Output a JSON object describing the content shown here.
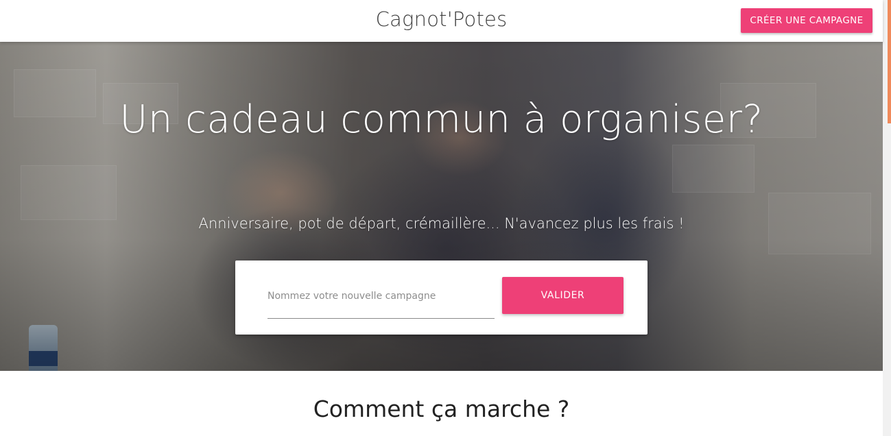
{
  "header": {
    "brand": "Cagnot'Potes",
    "create_campaign_label": "CRÉER UNE CAMPAGNE"
  },
  "hero": {
    "title": "Un cadeau commun à organiser?",
    "subtitle": "Anniversaire, pot de départ, crémaillère... N'avancez plus les frais !",
    "form": {
      "input_value": "",
      "input_placeholder": "Nommez votre nouvelle campagne",
      "submit_label": "VALIDER"
    }
  },
  "how_it_works": {
    "title": "Comment ça marche ?"
  },
  "colors": {
    "accent": "#ee4077",
    "scrollbar_thumb": "#f08a5b"
  }
}
